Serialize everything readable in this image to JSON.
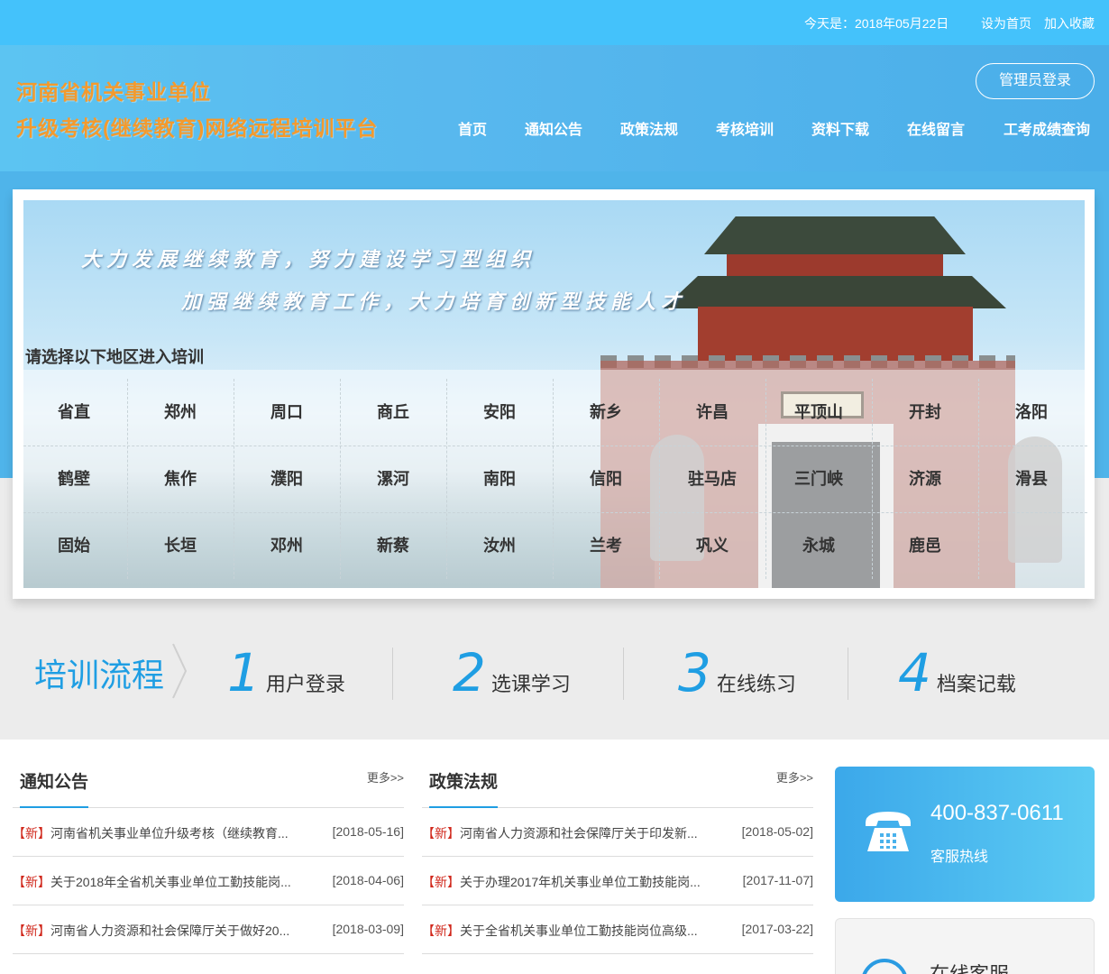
{
  "topbar": {
    "date_text": "今天是：2018年05月22日",
    "set_home": "设为首页",
    "add_favorite": "加入收藏"
  },
  "header": {
    "brand_line1": "河南省机关事业单位",
    "brand_line2": "升级考核(继续教育)网络远程培训平台",
    "admin_login": "管理员登录",
    "nav": [
      "首页",
      "通知公告",
      "政策法规",
      "考核培训",
      "资料下载",
      "在线留言",
      "工考成绩查询"
    ]
  },
  "banner": {
    "slogan1": "大力发展继续教育，努力建设学习型组织",
    "slogan2": "加强继续教育工作，大力培育创新型技能人才",
    "region_title": "请选择以下地区进入培训",
    "regions": [
      [
        "省直",
        "郑州",
        "周口",
        "商丘",
        "安阳",
        "新乡",
        "许昌",
        "平顶山",
        "开封",
        "洛阳"
      ],
      [
        "鹤壁",
        "焦作",
        "濮阳",
        "漯河",
        "南阳",
        "信阳",
        "驻马店",
        "三门峡",
        "济源",
        "滑县"
      ],
      [
        "固始",
        "长垣",
        "邓州",
        "新蔡",
        "汝州",
        "兰考",
        "巩义",
        "永城",
        "鹿邑"
      ]
    ]
  },
  "flow": {
    "title": "培训流程",
    "steps": [
      {
        "num": "1",
        "label": "用户登录"
      },
      {
        "num": "2",
        "label": "选课学习"
      },
      {
        "num": "3",
        "label": "在线练习"
      },
      {
        "num": "4",
        "label": "档案记载"
      }
    ]
  },
  "notices": {
    "title": "通知公告",
    "more": "更多>>",
    "tag": "【新】",
    "items": [
      {
        "text": "河南省机关事业单位升级考核（继续教育...",
        "date": "[2018-05-16]"
      },
      {
        "text": "关于2018年全省机关事业单位工勤技能岗...",
        "date": "[2018-04-06]"
      },
      {
        "text": "河南省人力资源和社会保障厅关于做好20...",
        "date": "[2018-03-09]"
      }
    ]
  },
  "policies": {
    "title": "政策法规",
    "more": "更多>>",
    "tag": "【新】",
    "items": [
      {
        "text": "河南省人力资源和社会保障厅关于印发新...",
        "date": "[2018-05-02]"
      },
      {
        "text": "关于办理2017年机关事业单位工勤技能岗...",
        "date": "[2017-11-07]"
      },
      {
        "text": "关于全省机关事业单位工勤技能岗位高级...",
        "date": "[2017-03-22]"
      }
    ]
  },
  "hotline": {
    "phone": "400-837-0611",
    "label": "客服热线",
    "icon": "telephone-icon"
  },
  "online_service": {
    "label": "在线客服",
    "icon": "headset-icon"
  },
  "colors": {
    "topbar": "#44c2fb",
    "accent": "#1f9ee3",
    "brand_text": "#f39a2e",
    "new_tag": "#d0281c"
  }
}
